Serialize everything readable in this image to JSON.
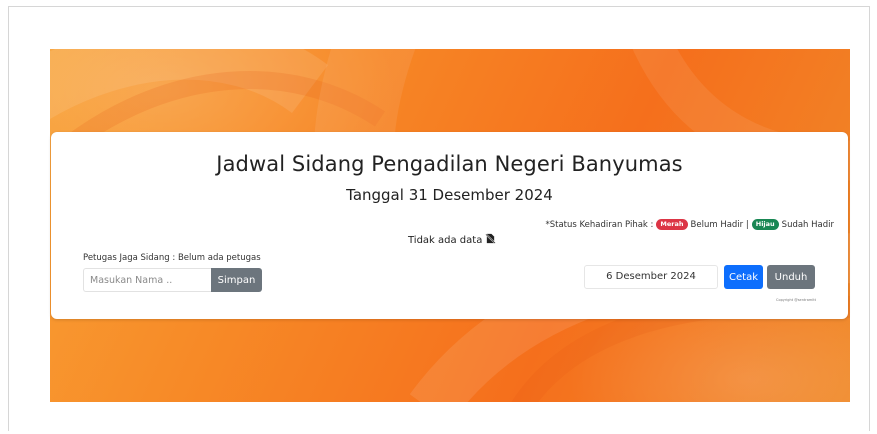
{
  "header": {
    "title": "Jadwal Sidang Pengadilan Negeri Banyumas",
    "date_line": "Tanggal 31 Desember 2024"
  },
  "status_legend": {
    "prefix": "*Status Kehadiran Pihak :",
    "red_badge": "Merah",
    "red_text": "Belum Hadir |",
    "green_badge": "Hijau",
    "green_text": "Sudah Hadir"
  },
  "table": {
    "empty_text": "Tidak ada data",
    "empty_icon": "file-slash-icon"
  },
  "petugas": {
    "label": "Petugas Jaga Sidang : Belum ada petugas",
    "input_placeholder": "Masukan Nama ..",
    "input_value": "",
    "save_label": "Simpan"
  },
  "print_controls": {
    "date_value": "6 Desember 2024",
    "print_label": "Cetak",
    "download_label": "Unduh"
  },
  "footer": {
    "copyright": "Copyright @sentramitt"
  },
  "colors": {
    "banner": "#f7861f",
    "red": "#dc3545",
    "green": "#198754",
    "primary": "#0d6efd",
    "secondary": "#6c757d"
  }
}
